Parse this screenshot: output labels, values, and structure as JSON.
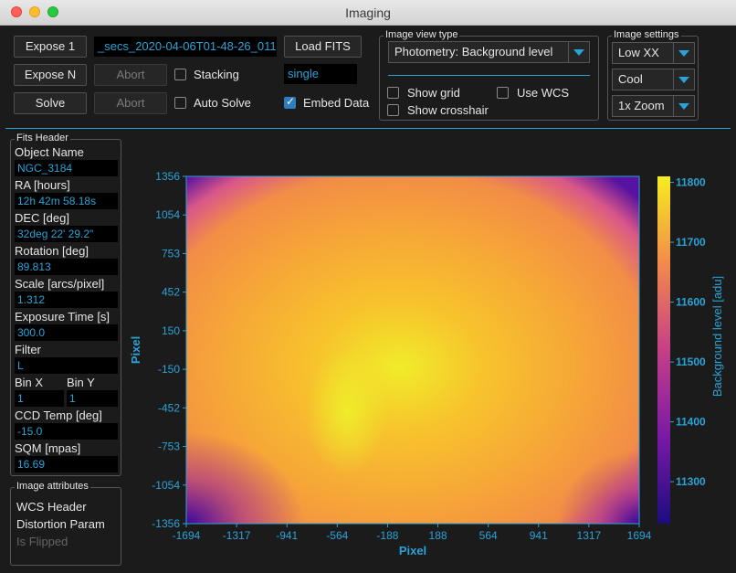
{
  "window": {
    "title": "Imaging"
  },
  "toolbar": {
    "expose1": "Expose 1",
    "exposeN": "Expose N",
    "solve": "Solve",
    "abort1": "Abort",
    "abort2": "Abort",
    "filename": "_secs_2020-04-06T01-48-26_011",
    "load_fits": "Load FITS",
    "stacking": "Stacking",
    "stacking_checked": false,
    "auto_solve": "Auto Solve",
    "auto_solve_checked": false,
    "mode": "single",
    "embed_data": "Embed Data",
    "embed_data_checked": true
  },
  "view_type": {
    "group_title": "Image view type",
    "selected": "Photometry: Background level",
    "show_grid": "Show grid",
    "use_wcs": "Use WCS",
    "show_crosshair": "Show crosshair"
  },
  "image_settings": {
    "group_title": "Image settings",
    "stretch": "Low XX",
    "colormap": "Cool",
    "zoom": "1x Zoom"
  },
  "fits_header": {
    "group_title": "Fits Header",
    "fields": [
      {
        "label": "Object Name",
        "value": "NGC_3184"
      },
      {
        "label": "RA [hours]",
        "value": "12h 42m 58.18s"
      },
      {
        "label": "DEC [deg]",
        "value": "32deg 22' 29.2\""
      },
      {
        "label": "Rotation [deg]",
        "value": "89.813"
      },
      {
        "label": "Scale [arcs/pixel]",
        "value": "1.312"
      },
      {
        "label": "Exposure Time [s]",
        "value": "300.0"
      },
      {
        "label": "Filter",
        "value": "L"
      }
    ],
    "bin_x_label": "Bin X",
    "bin_y_label": "Bin Y",
    "bin_x": "1",
    "bin_y": "1",
    "ccd_temp_label": "CCD Temp [deg]",
    "ccd_temp": "-15.0",
    "sqm_label": "SQM [mpas]",
    "sqm": "16.69"
  },
  "image_attributes": {
    "group_title": "Image attributes",
    "wcs_header": "WCS Header",
    "distortion_param": "Distortion Param",
    "is_flipped": "Is Flipped"
  },
  "chart_data": {
    "type": "heatmap",
    "xlabel": "Pixel",
    "ylabel": "Pixel",
    "x_ticks": [
      "-1694",
      "-1317",
      "-941",
      "-564",
      "-188",
      "188",
      "564",
      "941",
      "1317",
      "1694"
    ],
    "y_ticks": [
      "1356",
      "1054",
      "753",
      "452",
      "150",
      "-150",
      "-452",
      "-753",
      "-1054",
      "-1356"
    ],
    "xlim": [
      -1694,
      1694
    ],
    "ylim": [
      -1356,
      1356
    ],
    "colorbar": {
      "label": "Background level [adu]",
      "ticks": [
        "11800",
        "11700",
        "11600",
        "11500",
        "11400",
        "11300"
      ],
      "range": [
        11230,
        11810
      ]
    },
    "colors": {
      "low": "#2a0a8a",
      "mid_low": "#b0308a",
      "mid": "#f07a45",
      "high": "#f5e620"
    }
  }
}
